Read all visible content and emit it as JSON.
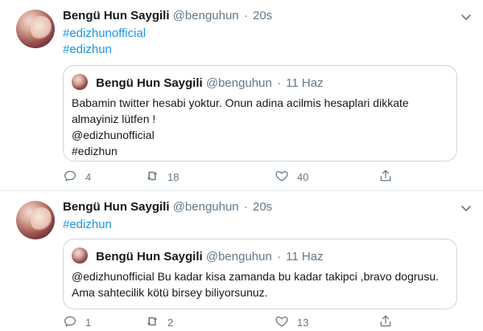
{
  "tweets": [
    {
      "author": {
        "name": "Bengü Hun Saygili",
        "handle": "@benguhun"
      },
      "separator": "·",
      "time": "20s",
      "hashtags": [
        "#edizhunofficial",
        "#edizhun"
      ],
      "quote": {
        "author": {
          "name": "Bengü Hun Saygili",
          "handle": "@benguhun"
        },
        "separator": "·",
        "time": "11 Haz",
        "lines": [
          "Babamin twitter hesabi yoktur. Onun adina acilmis hesaplari dikkate",
          "almayiniz lütfen !",
          "@edizhunofficial",
          "#edizhun"
        ]
      },
      "actions": {
        "replies": "4",
        "retweets": "18",
        "likes": "40"
      }
    },
    {
      "author": {
        "name": "Bengü Hun Saygili",
        "handle": "@benguhun"
      },
      "separator": "·",
      "time": "20s",
      "hashtags": [
        "#edizhun"
      ],
      "quote": {
        "author": {
          "name": "Bengü Hun Saygili",
          "handle": "@benguhun"
        },
        "separator": "·",
        "time": "11 Haz",
        "lines": [
          "@edizhunofficial Bu kadar kisa zamanda bu kadar takipci ,bravo dogrusu.",
          "Ama sahtecilik kötü birsey biliyorsunuz."
        ]
      },
      "actions": {
        "replies": "1",
        "retweets": "2",
        "likes": "13"
      }
    }
  ],
  "icons": {
    "caret": "chevron-down-icon",
    "reply": "reply-icon",
    "retweet": "retweet-icon",
    "like": "heart-icon",
    "share": "share-icon"
  },
  "colors": {
    "link": "#1b95e0",
    "muted": "#657786",
    "border": "#ccd6dd",
    "divider": "#e6ecf0",
    "text": "#14171a"
  }
}
